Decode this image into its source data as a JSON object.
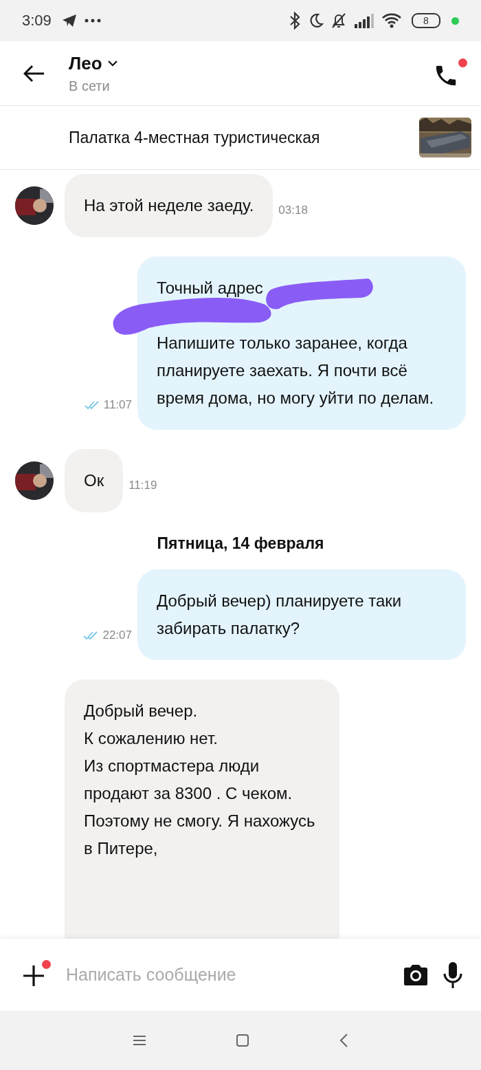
{
  "status_bar": {
    "time": "3:09",
    "battery": "8"
  },
  "header": {
    "name": "Лео",
    "status": "В сети",
    "call_notification": true
  },
  "listing": {
    "title": "Палатка 4-местная туристическая"
  },
  "messages": [
    {
      "kind": "incoming",
      "text": "На этой неделе заеду.",
      "time": "03:18"
    },
    {
      "kind": "outgoing",
      "text": "Точный адрес\n\nНапишите только заранее, когда планируете заехать. Я почти всё время дома, но могу уйти по делам.",
      "time": "11:07",
      "read": true,
      "redacted": true
    },
    {
      "kind": "incoming",
      "text": "Ок",
      "time": "11:19"
    },
    {
      "kind": "date",
      "text": "Пятница, 14 февраля"
    },
    {
      "kind": "outgoing",
      "text": "Добрый вечер) планируете таки забирать палатку?",
      "time": "22:07",
      "read": true
    },
    {
      "kind": "incoming",
      "text": "Добрый вечер.\nК сожалению нет.\nИз спортмастера люди продают за 8300 . С чеком.\nПоэтому не смогу. Я нахожусь в Питере,"
    }
  ],
  "composer": {
    "placeholder": "Написать сообщение",
    "attach_notification": true
  }
}
